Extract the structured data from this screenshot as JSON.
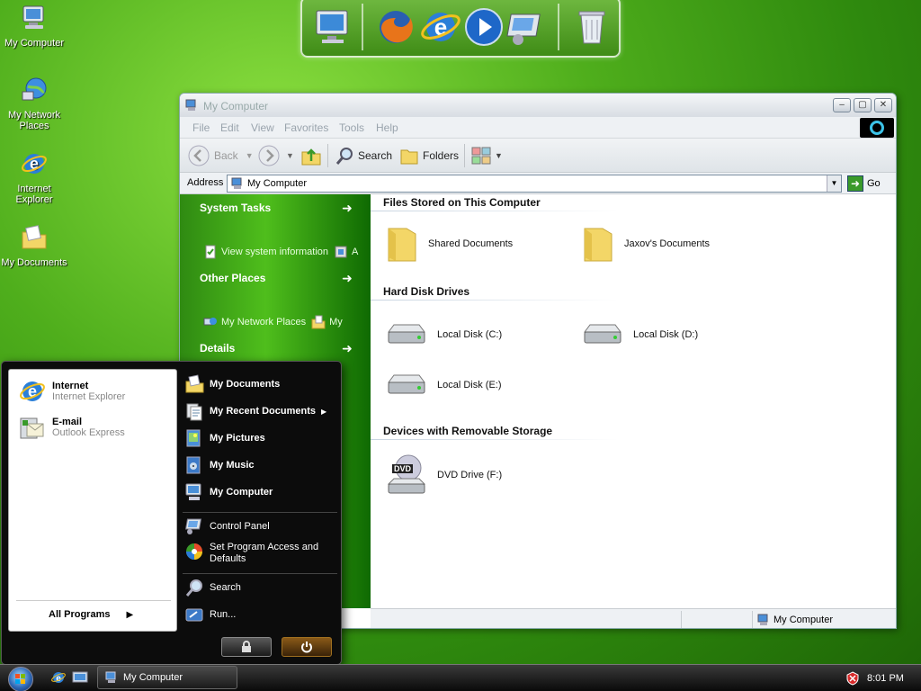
{
  "desktop": {
    "icons": [
      {
        "label": "My Computer"
      },
      {
        "label": "My Network Places"
      },
      {
        "label": "Internet Explorer"
      },
      {
        "label": "My Documents"
      }
    ]
  },
  "window": {
    "title": "My Computer",
    "menu": [
      "File",
      "Edit",
      "View",
      "Favorites",
      "Tools",
      "Help"
    ],
    "toolbar": {
      "back": "Back",
      "search": "Search",
      "folders": "Folders"
    },
    "address": {
      "label": "Address",
      "value": "My Computer",
      "go": "Go"
    },
    "left_panel": {
      "system_tasks": "System Tasks",
      "view_system_info": "View system information",
      "add_remove_prefix": "A",
      "other_places": "Other Places",
      "my_network_places": "My Network Places",
      "my_prefix": "My",
      "details": "Details"
    },
    "sections": {
      "files_stored": "Files Stored on This Computer",
      "hard_disks": "Hard Disk Drives",
      "removable": "Devices with Removable Storage"
    },
    "items": {
      "shared_docs": "Shared Documents",
      "jaxov_docs": "Jaxov's Documents",
      "disk_c": "Local Disk (C:)",
      "disk_d": "Local Disk (D:)",
      "disk_e": "Local Disk (E:)",
      "dvd": "DVD Drive (F:)",
      "dvd_badge": "DVD"
    },
    "status": "My Computer"
  },
  "start_menu": {
    "pinned": [
      {
        "name": "Internet",
        "sub": "Internet Explorer"
      },
      {
        "name": "E-mail",
        "sub": "Outlook Express"
      }
    ],
    "all_programs": "All Programs",
    "right": {
      "my_documents": "My Documents",
      "recent": "My Recent Documents",
      "pictures": "My Pictures",
      "music": "My Music",
      "computer": "My Computer",
      "control_panel": "Control Panel",
      "program_access": "Set Program Access and",
      "program_access_2": "Defaults",
      "search": "Search",
      "run": "Run..."
    }
  },
  "taskbar": {
    "task": "My Computer",
    "clock": "8:01 PM"
  },
  "colors": {
    "desktop_green": "#3f9a14",
    "panel_green": "#2f8a12",
    "start_bg": "#0c0c0c"
  }
}
